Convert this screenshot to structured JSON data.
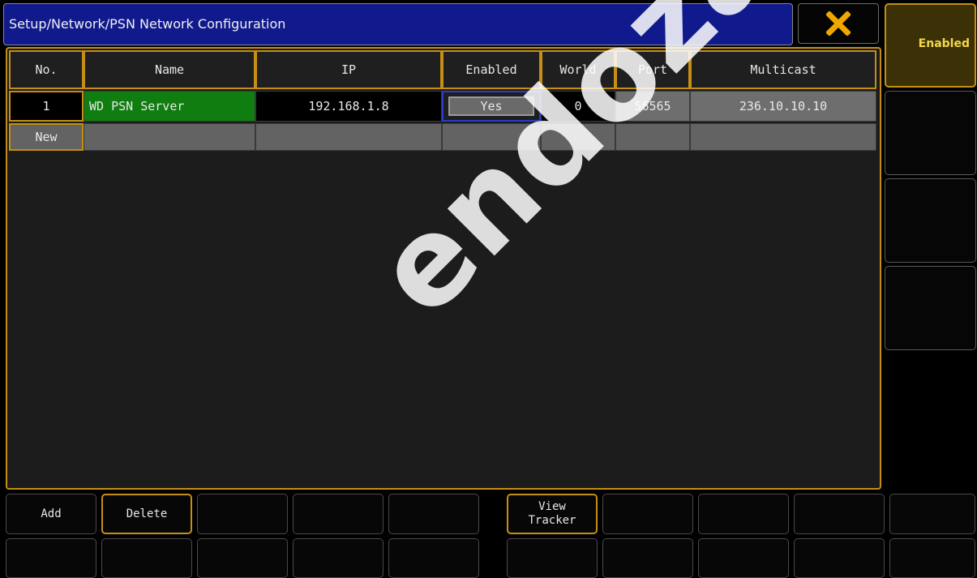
{
  "title": "Setup/Network/PSN Network Configuration",
  "close_icon": "close-icon",
  "table": {
    "headers": [
      "No.",
      "Name",
      "IP",
      "Enabled",
      "World",
      "Port",
      "Multicast"
    ],
    "rows": [
      [
        "1",
        "WD PSN Server",
        "192.168.1.8",
        "Yes",
        "0",
        "56565",
        "236.10.10.10"
      ]
    ],
    "new_label": "New"
  },
  "sidebar": {
    "enabled_label": "Enabled"
  },
  "fkeys": {
    "add": "Add",
    "delete": "Delete",
    "view_tracker": "View\nTracker"
  },
  "watermark": "endoza.com.m",
  "colors": {
    "accent": "#c48f14",
    "title_bg": "#111a8c",
    "name_cell": "#0f7d0f",
    "close_x": "#f0a800"
  }
}
